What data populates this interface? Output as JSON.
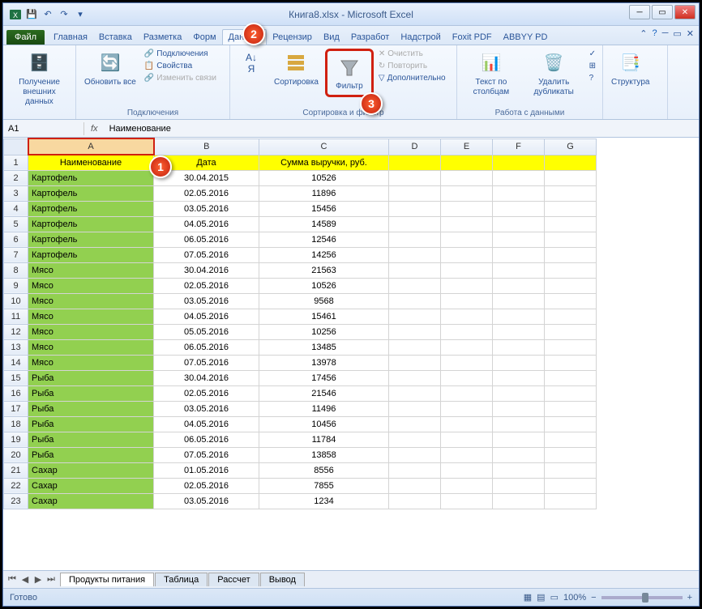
{
  "title": "Книга8.xlsx - Microsoft Excel",
  "tabs": {
    "file": "Файл",
    "home": "Главная",
    "insert": "Вставка",
    "layout": "Разметка",
    "formulas": "Форм",
    "data": "Данные",
    "review": "Рецензир",
    "view": "Вид",
    "dev": "Разработ",
    "addins": "Надстрой",
    "foxit": "Foxit PDF",
    "abbyy": "ABBYY PD"
  },
  "ribbon": {
    "g1": {
      "btn1": "Получение внешних данных",
      "label": ""
    },
    "g2": {
      "btn1": "Обновить все",
      "s1": "Подключения",
      "s2": "Свойства",
      "s3": "Изменить связи",
      "label": "Подключения"
    },
    "g3": {
      "sort": "Сортировка",
      "filter": "Фильтр",
      "s1": "Очистить",
      "s2": "Повторить",
      "s3": "Дополнительно",
      "label": "Сортировка и фильтр"
    },
    "g4": {
      "b1": "Текст по столбцам",
      "b2": "Удалить дубликаты",
      "label": "Работа с данными"
    },
    "g5": {
      "b1": "Структура",
      "label": ""
    }
  },
  "namebox": "A1",
  "formula": "Наименование",
  "columns": [
    "A",
    "B",
    "C",
    "D",
    "E",
    "F",
    "G"
  ],
  "headers": {
    "a": "Наименование",
    "b": "Дата",
    "c": "Сумма выручки, руб."
  },
  "rows": [
    {
      "a": "Картофель",
      "b": "30.04.2015",
      "c": "10526"
    },
    {
      "a": "Картофель",
      "b": "02.05.2016",
      "c": "11896"
    },
    {
      "a": "Картофель",
      "b": "03.05.2016",
      "c": "15456"
    },
    {
      "a": "Картофель",
      "b": "04.05.2016",
      "c": "14589"
    },
    {
      "a": "Картофель",
      "b": "06.05.2016",
      "c": "12546"
    },
    {
      "a": "Картофель",
      "b": "07.05.2016",
      "c": "14256"
    },
    {
      "a": "Мясо",
      "b": "30.04.2016",
      "c": "21563"
    },
    {
      "a": "Мясо",
      "b": "02.05.2016",
      "c": "10526"
    },
    {
      "a": "Мясо",
      "b": "03.05.2016",
      "c": "9568"
    },
    {
      "a": "Мясо",
      "b": "04.05.2016",
      "c": "15461"
    },
    {
      "a": "Мясо",
      "b": "05.05.2016",
      "c": "10256"
    },
    {
      "a": "Мясо",
      "b": "06.05.2016",
      "c": "13485"
    },
    {
      "a": "Мясо",
      "b": "07.05.2016",
      "c": "13978"
    },
    {
      "a": "Рыба",
      "b": "30.04.2016",
      "c": "17456"
    },
    {
      "a": "Рыба",
      "b": "02.05.2016",
      "c": "21546"
    },
    {
      "a": "Рыба",
      "b": "03.05.2016",
      "c": "11496"
    },
    {
      "a": "Рыба",
      "b": "04.05.2016",
      "c": "10456"
    },
    {
      "a": "Рыба",
      "b": "06.05.2016",
      "c": "11784"
    },
    {
      "a": "Рыба",
      "b": "07.05.2016",
      "c": "13858"
    },
    {
      "a": "Сахар",
      "b": "01.05.2016",
      "c": "8556"
    },
    {
      "a": "Сахар",
      "b": "02.05.2016",
      "c": "7855"
    },
    {
      "a": "Сахар",
      "b": "03.05.2016",
      "c": "1234"
    }
  ],
  "sheets": [
    "Продукты питания",
    "Таблица",
    "Рассчет",
    "Вывод"
  ],
  "status": "Готово",
  "zoom": "100%",
  "callouts": {
    "c1": "1",
    "c2": "2",
    "c3": "3"
  }
}
